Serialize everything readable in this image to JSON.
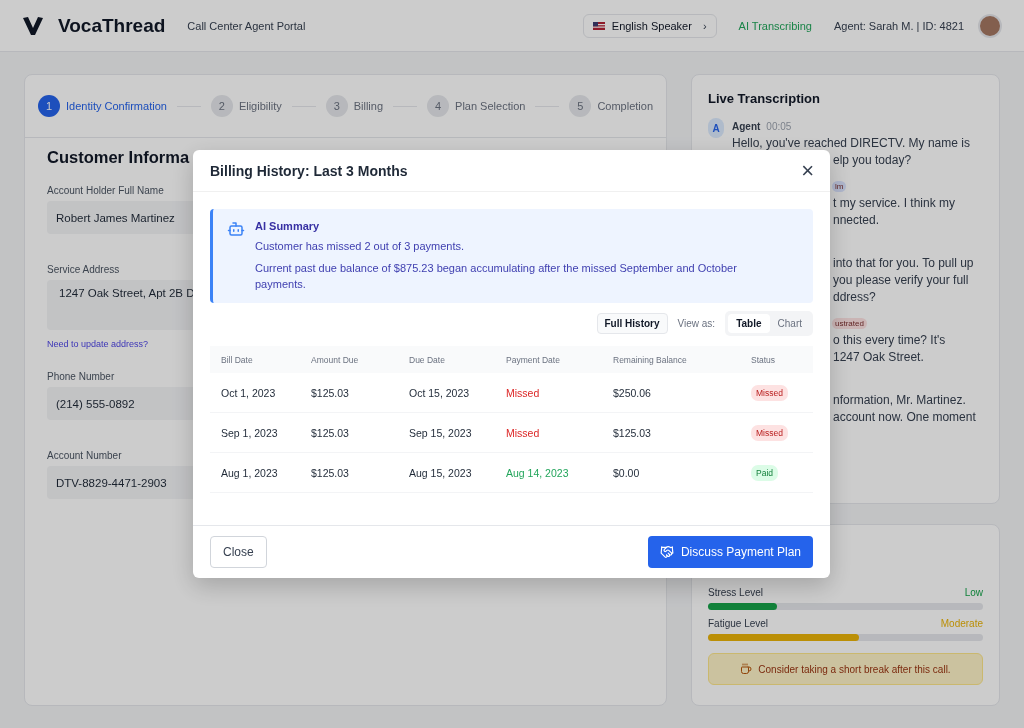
{
  "header": {
    "brand": "VocaThread",
    "subtitle": "Call Center Agent Portal",
    "language": "English Speaker",
    "caret": "›",
    "status": "AI Transcribing",
    "agent": "Agent: Sarah M. | ID: 4821"
  },
  "stepper": [
    {
      "number": "1",
      "label": "Identity Confirmation",
      "selected": true
    },
    {
      "number": "2",
      "label": "Eligibility",
      "selected": false
    },
    {
      "number": "3",
      "label": "Billing",
      "selected": false
    },
    {
      "number": "4",
      "label": "Plan Selection",
      "selected": false
    },
    {
      "number": "5",
      "label": "Completion",
      "selected": false
    }
  ],
  "customer": {
    "heading": "Customer Informa",
    "fields": [
      {
        "label": "Account Holder Full Name",
        "value": "Robert James Martinez",
        "kind": "input"
      },
      {
        "label": "Service Address",
        "value": "1247 Oak Street, Apt 2B D",
        "kind": "textarea",
        "link": "Need to update address?"
      },
      {
        "label": "Phone Number",
        "value": "(214) 555-0892",
        "kind": "input"
      },
      {
        "label": "Account Number",
        "value": "DTV-8829-4471-2903",
        "kind": "input"
      }
    ]
  },
  "transcription": {
    "title": "Live Transcription",
    "messages": [
      {
        "avatar": "A",
        "speaker": "Agent",
        "time": "00:05",
        "lines": [
          "Hello, you've reached DIRECTV. My name is"
        ],
        "cut_lines": [
          "elp you today?"
        ]
      },
      {
        "badge": {
          "text": "lm",
          "kind": "calm"
        },
        "cut_lines": [
          "t my service. I think my",
          "nnected."
        ]
      },
      {
        "cut_lines": [
          "into that for you. To pull up",
          "you please verify your full",
          "ddress?"
        ]
      },
      {
        "badge": {
          "text": "ustrated",
          "kind": "frustrated"
        },
        "cut_lines": [
          "o this every time? It's",
          "1247 Oak Street."
        ]
      },
      {
        "cut_lines": [
          "nformation, Mr. Martinez.",
          "account now. One moment"
        ]
      }
    ]
  },
  "wellbeing": {
    "meters": [
      {
        "label": "Stress Level",
        "reading": "Low",
        "level": 0.25,
        "kind": "low"
      },
      {
        "label": "Fatigue Level",
        "reading": "Moderate",
        "level": 0.55,
        "kind": "moderate"
      }
    ],
    "notice": "Consider taking a short break after this call."
  },
  "modal": {
    "title": "Billing History: Last 3 Months",
    "close": "×",
    "summary": {
      "title": "AI Summary",
      "lines": [
        "Customer has missed 2 out of 3 payments.",
        "Current past due balance of $875.23 began accumulating after the missed September and October payments."
      ]
    },
    "full_history": "Full History",
    "view_as": "View as:",
    "views": [
      {
        "label": "Table",
        "selected": true
      },
      {
        "label": "Chart",
        "selected": false
      }
    ],
    "columns": [
      "Bill Date",
      "Amount Due",
      "Due Date",
      "Payment Date",
      "Remaining Balance",
      "Status"
    ],
    "rows": [
      {
        "bill_date": "Oct 1, 2023",
        "amount_due": "$125.03",
        "due_date": "Oct 15, 2023",
        "payment_date": "Missed",
        "remaining": "$250.06",
        "status": "Missed",
        "kind": "missed"
      },
      {
        "bill_date": "Sep 1, 2023",
        "amount_due": "$125.03",
        "due_date": "Sep 15, 2023",
        "payment_date": "Missed",
        "remaining": "$125.03",
        "status": "Missed",
        "kind": "missed"
      },
      {
        "bill_date": "Aug 1, 2023",
        "amount_due": "$125.03",
        "due_date": "Aug 15, 2023",
        "payment_date": "Aug 14, 2023",
        "remaining": "$0.00",
        "status": "Paid",
        "kind": "paid"
      }
    ],
    "buttons": {
      "close": "Close",
      "primary": "Discuss Payment Plan"
    }
  }
}
